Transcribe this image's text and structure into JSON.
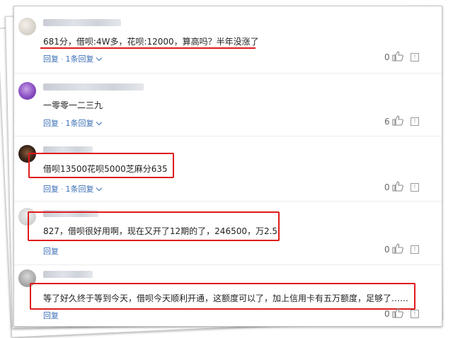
{
  "comments": [
    {
      "text": "681分，借呗:4W多，花呗:12000，算高吗？半年没涨了",
      "reply_label": "回复",
      "replies_label": "1条回复",
      "likes": "0"
    },
    {
      "text": "一零零一二三九",
      "reply_label": "回复",
      "replies_label": "1条回复",
      "likes": "6"
    },
    {
      "text": "借呗13500花呗5000芝麻分635",
      "reply_label": "回复",
      "replies_label": "1条回复",
      "likes": "0"
    },
    {
      "text": "827，借呗很好用啊，现在又开了12期的了，246500，万2.5",
      "reply_label": "回复",
      "likes": "0"
    },
    {
      "text": "等了好久终于等到今天，借呗今天顺利开通，这额度可以了，加上信用卡有五万额度，足够了……",
      "reply_label": "回复",
      "likes": "0"
    }
  ],
  "icons": {
    "thumb": "thumbs-up-icon",
    "report": "report-icon",
    "expand": "chevron-down-icon"
  },
  "colors": {
    "highlight": "#e01a1a",
    "link": "#3b6fb6"
  }
}
